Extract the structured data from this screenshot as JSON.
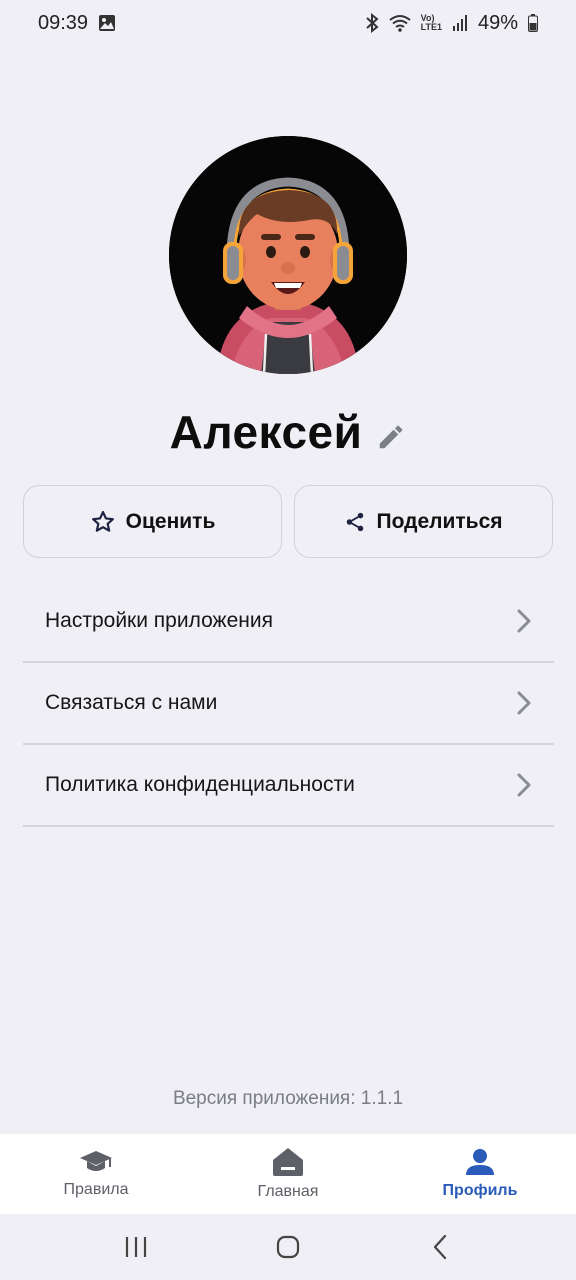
{
  "status": {
    "time": "09:39",
    "battery": "49%",
    "network_label_top": "Vo)",
    "network_label_bottom": "LTE1"
  },
  "profile": {
    "name": "Алексей"
  },
  "actions": {
    "rate_label": "Оценить",
    "share_label": "Поделиться"
  },
  "menu": [
    {
      "label": "Настройки приложения"
    },
    {
      "label": "Связаться с нами"
    },
    {
      "label": "Политика конфиденциальности"
    }
  ],
  "version_text": "Версия приложения: 1.1.1",
  "bottom_nav": [
    {
      "label": "Правила",
      "icon": "graduation-cap-icon"
    },
    {
      "label": "Главная",
      "icon": "home-icon"
    },
    {
      "label": "Профиль",
      "icon": "person-icon",
      "active": true
    }
  ],
  "colors": {
    "background": "#efeff5",
    "accent": "#2a5bb8",
    "divider": "#d3d4dc"
  }
}
